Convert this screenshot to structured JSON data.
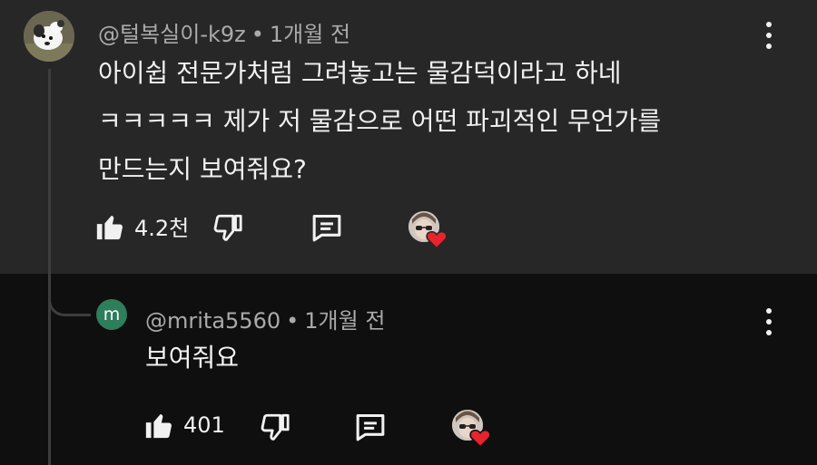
{
  "comment": {
    "author": "@털복실이-k9z",
    "separator": "•",
    "time": "1개월 전",
    "text_lines": [
      "아이쉽 전문가처럼 그려놓고는 물감덕이라고 하네",
      "ㅋㅋㅋㅋㅋ 제가 저 물감으로 어떤 파괴적인 무언가를",
      "만드는지 보여줘요?"
    ],
    "like_count": "4.2천",
    "icons": {
      "like": "thumbs-up-icon",
      "dislike": "thumbs-down-icon",
      "reply": "reply-comment-icon",
      "creator_heart": "creator-heart-icon",
      "menu": "more-vert-icon"
    }
  },
  "reply": {
    "avatar_letter": "m",
    "author": "@mrita5560",
    "separator": "•",
    "time": "1개월 전",
    "text": "보여줘요",
    "like_count": "401"
  },
  "colors": {
    "top_background": "#272727",
    "reply_background": "#0f0f0f",
    "heart": "#e8232e",
    "avatar_m": "#2e7d5b"
  }
}
